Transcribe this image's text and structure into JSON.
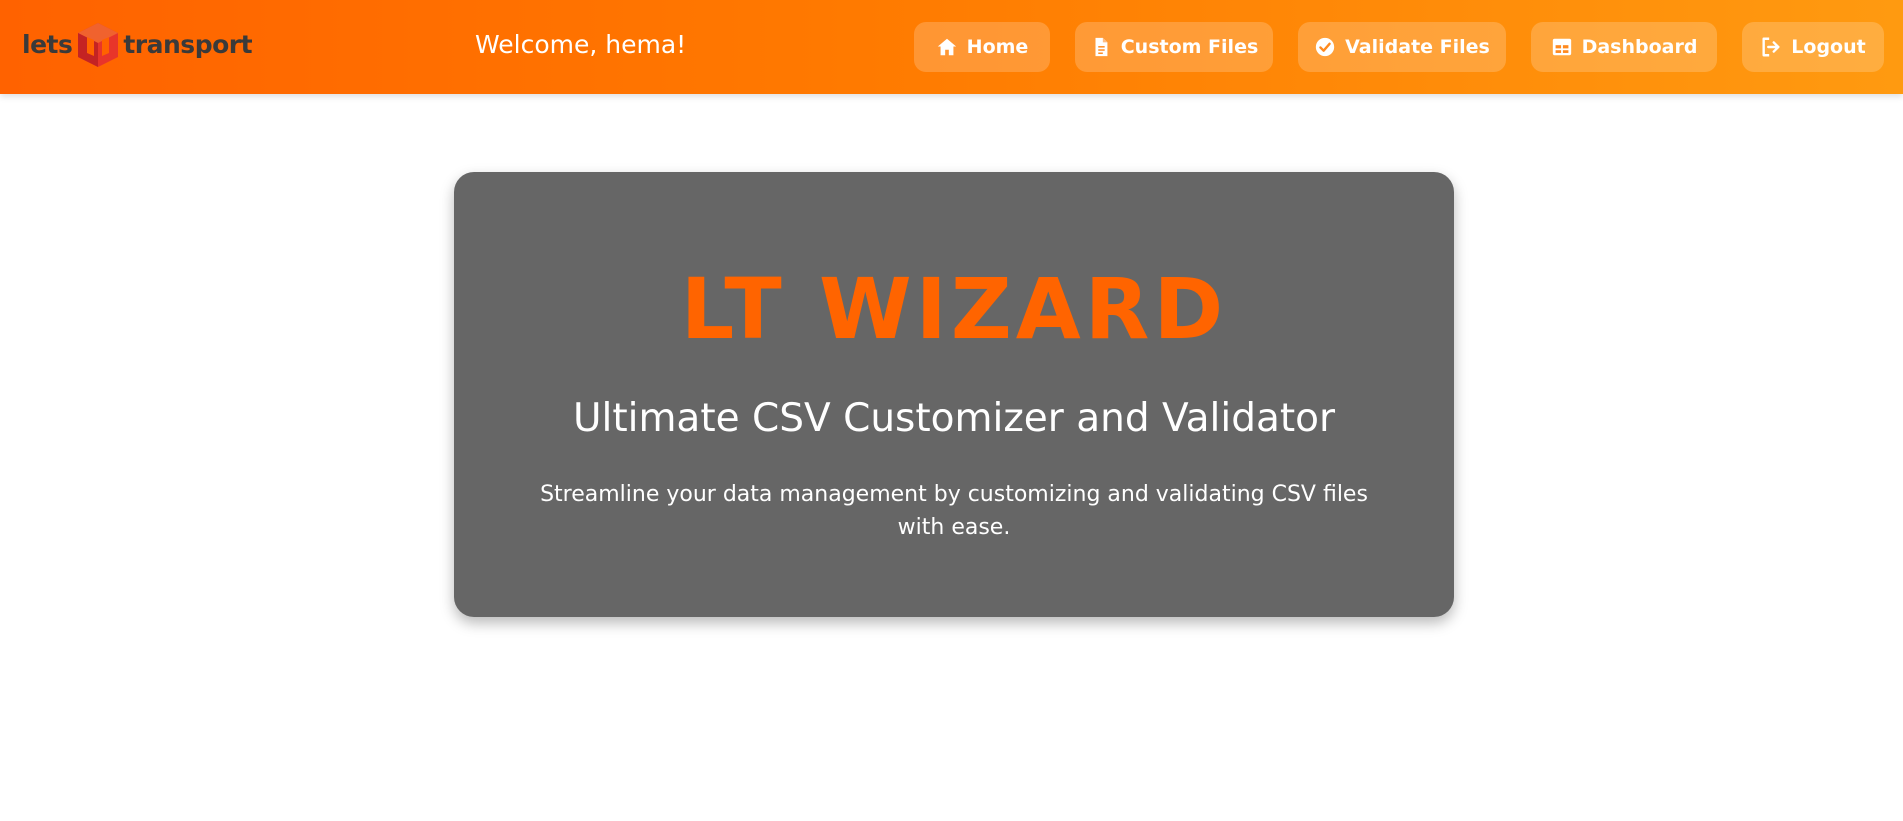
{
  "header": {
    "logo": {
      "text_left": "lets",
      "text_right": "transport",
      "mark_icon": "cube-logo-icon"
    },
    "welcome": "Welcome, hema!",
    "nav": [
      {
        "label": "Home",
        "icon": "home-icon"
      },
      {
        "label": "Custom Files",
        "icon": "file-icon"
      },
      {
        "label": "Validate Files",
        "icon": "check-circle-icon"
      },
      {
        "label": "Dashboard",
        "icon": "dashboard-grid-icon"
      },
      {
        "label": "Logout",
        "icon": "logout-icon"
      }
    ]
  },
  "hero": {
    "title": "LT WIZARD",
    "subtitle": "Ultimate CSV Customizer and Validator",
    "description": "Streamline your data management by customizing and validating CSV files with ease."
  },
  "colors": {
    "header_gradient_start": "#ff6200",
    "header_gradient_end": "#ff9a10",
    "hero_background": "#666666",
    "accent": "#ff6400"
  }
}
